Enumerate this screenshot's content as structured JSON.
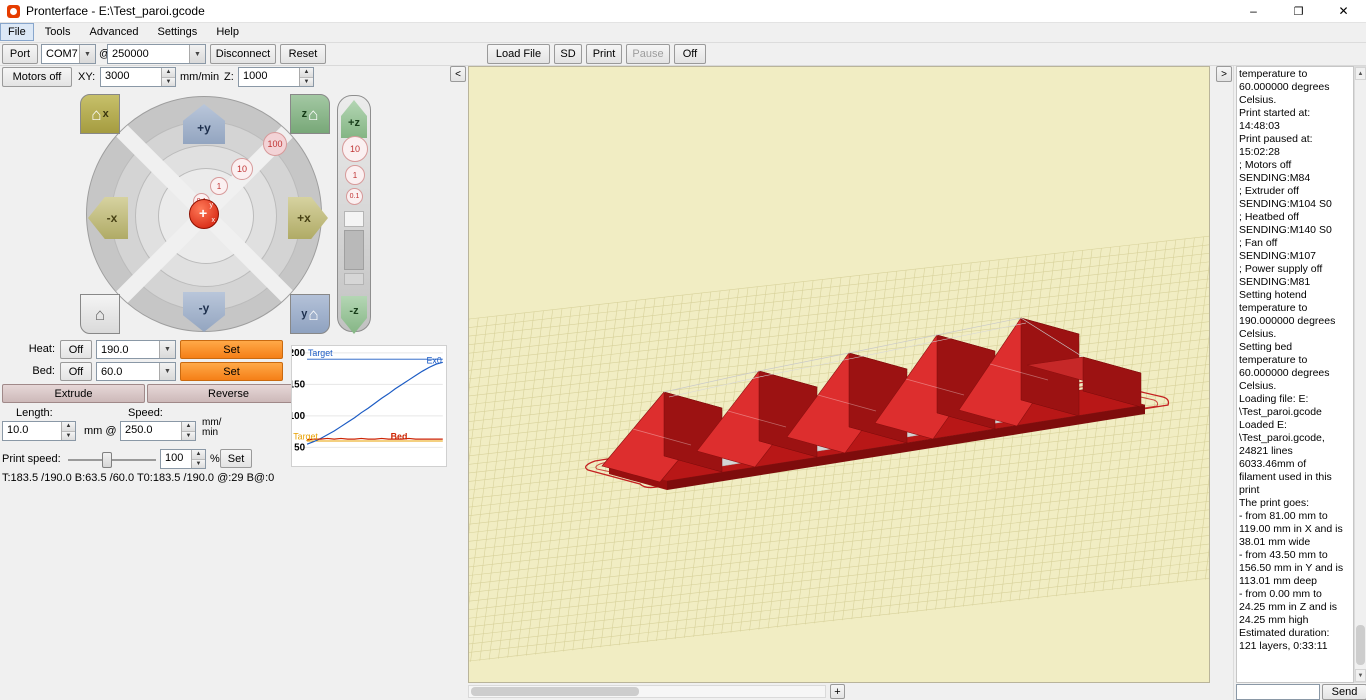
{
  "window": {
    "title": "Pronterface - E:\\Test_paroi.gcode",
    "minimize": "–",
    "maximize": "❐",
    "close": "✕"
  },
  "menu": {
    "items": [
      "File",
      "Tools",
      "Advanced",
      "Settings",
      "Help"
    ]
  },
  "toolbar": {
    "port": "Port",
    "port_value": "COM7",
    "at": "@",
    "baud_value": "250000",
    "disconnect": "Disconnect",
    "reset": "Reset",
    "load_file": "Load File",
    "sd": "SD",
    "print": "Print",
    "pause": "Pause",
    "off": "Off"
  },
  "motion": {
    "motors_off": "Motors off",
    "xy_label": "XY:",
    "xy_value": "3000",
    "units": "mm/min",
    "z_label": "Z:",
    "z_value": "1000"
  },
  "jog": {
    "home_x": "x",
    "home_z": "z",
    "home_y": "y",
    "plus_y": "+y",
    "minus_y": "-y",
    "minus_x": "-x",
    "plus_x": "+x",
    "steps": [
      "100",
      "10",
      "1",
      "0.1"
    ],
    "center_axis_y": "y",
    "center_axis_x": "x"
  },
  "zcontrol": {
    "plus_z": "+z",
    "minus_z": "-z",
    "steps": [
      "10",
      "1",
      "0.1"
    ]
  },
  "temps": {
    "heat_label": "Heat:",
    "heat_off": "Off",
    "heat_value": "190.0",
    "heat_set": "Set",
    "bed_label": "Bed:",
    "bed_off": "Off",
    "bed_value": "60.0",
    "bed_set": "Set"
  },
  "extrude": {
    "extrude": "Extrude",
    "reverse": "Reverse",
    "length_label": "Length:",
    "speed_label": "Speed:",
    "length_value": "10.0",
    "mm_at": "mm @",
    "speed_value": "250.0",
    "speed_units_1": "mm/",
    "speed_units_2": "min"
  },
  "print_speed": {
    "label": "Print speed:",
    "value": "100",
    "percent": "%",
    "set": "Set"
  },
  "status_line": "T:183.5 /190.0 B:63.5 /60.0 T0:183.5 /190.0 @:29 B@:0",
  "temp_graph": {
    "type": "line",
    "ylabels": [
      "200",
      "150",
      "100",
      "50"
    ],
    "labels": {
      "hot_target": "Target",
      "ex0": "Ex0",
      "bed_target": "Target",
      "bed": "Bed"
    },
    "colors": {
      "ex0": "#1b5bc4",
      "bed": "#cc2200",
      "bed_target": "#e8a000",
      "grid": "#e6e6e6"
    },
    "hot_target_value": 190,
    "bed_target_value": 60,
    "series": [
      {
        "name": "Ex0",
        "color": "#1b5bc4",
        "values": [
          55,
          59,
          64,
          70,
          76,
          83,
          90,
          97,
          105,
          112,
          120,
          128,
          135,
          143,
          150,
          157,
          164,
          171,
          177,
          182,
          185
        ]
      },
      {
        "name": "Bed",
        "color": "#cc2200",
        "values": [
          62,
          63,
          63,
          64,
          63,
          64,
          63,
          63,
          64,
          63,
          63,
          64,
          63,
          63,
          63,
          64,
          63,
          63,
          63,
          63,
          63
        ]
      }
    ]
  },
  "viewport": {
    "collapse_left": "<",
    "collapse_right": ">",
    "zoom_plus": "+"
  },
  "log": {
    "text": "temperature to\n60.000000 degrees\nCelsius.\nPrint started at:\n14:48:03\nPrint paused at:\n15:02:28\n; Motors off\nSENDING:M84\n; Extruder off\nSENDING:M104 S0\n; Heatbed off\nSENDING:M140 S0\n; Fan off\nSENDING:M107\n; Power supply off\nSENDING:M81\nSetting hotend\ntemperature to\n190.000000 degrees\nCelsius.\nSetting bed\ntemperature to\n60.000000 degrees\nCelsius.\nLoading file: E:\n\\Test_paroi.gcode\nLoaded E:\n\\Test_paroi.gcode,\n24821 lines\n6033.46mm of\nfilament used in this\nprint\nThe print goes:\n- from 81.00 mm to\n119.00 mm in X and is\n38.01 mm wide\n- from 43.50 mm to\n156.50 mm in Y and is\n113.01 mm deep\n- from 0.00 mm to\n24.25 mm in Z and is\n24.25 mm high\nEstimated duration:\n121 layers, 0:33:11"
  },
  "send": {
    "button": "Send",
    "input_value": ""
  },
  "icons": {
    "dropdown": "▼",
    "spin_up": "▲",
    "spin_down": "▼",
    "home": "⌂",
    "scroll_up": "▲",
    "scroll_down": "▼",
    "knob_cross": "+"
  }
}
